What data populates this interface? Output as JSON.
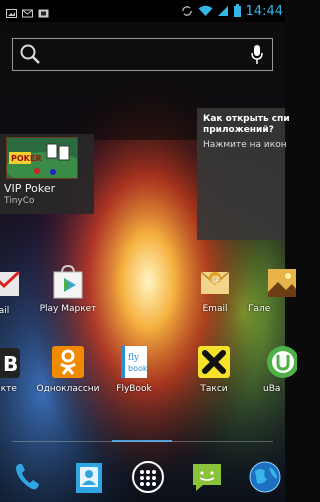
{
  "status_bar": {
    "time": "14:44",
    "notifications": [
      "picture-icon",
      "mail-icon",
      "screenshot-icon"
    ],
    "indicators": [
      "sync-icon",
      "wifi-icon",
      "signal-icon",
      "battery-icon"
    ]
  },
  "search": {
    "icons": [
      "search-icon",
      "microphone-icon"
    ]
  },
  "widgets": {
    "vip": {
      "title": "VIP Poker",
      "subtitle": "TinyCo"
    },
    "hint": {
      "title_line1": "Как открыть спи",
      "title_line2": "приложений?",
      "body": "Нажмите на икон"
    }
  },
  "apps_row1": [
    {
      "label": "ail"
    },
    {
      "label": "Play Маркет"
    },
    {
      "label": "Email"
    },
    {
      "label": "Гале"
    }
  ],
  "apps_row2": [
    {
      "label": "акте"
    },
    {
      "label": "Одноклассни"
    },
    {
      "label": "FlyBook"
    },
    {
      "label": "Такси"
    },
    {
      "label": "uBa"
    }
  ],
  "dock": {
    "icons": [
      "phone-icon",
      "contacts-icon",
      "apps-drawer-icon",
      "messaging-icon",
      "browser-icon"
    ]
  },
  "colors": {
    "accent": "#33b5e5",
    "taxi": "#f6e22a",
    "odnoklassniki": "#f08a00",
    "flybook": "#2d8ed6"
  }
}
